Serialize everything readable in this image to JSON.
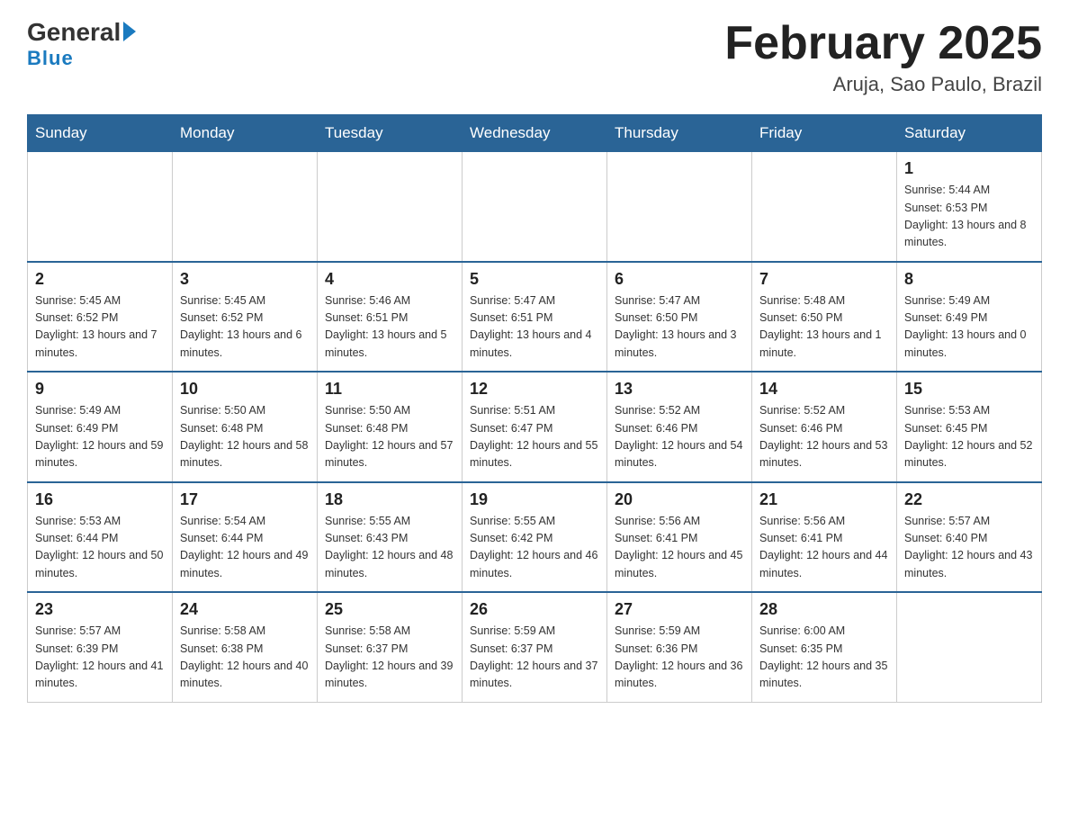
{
  "header": {
    "logo_general": "General",
    "logo_blue": "Blue",
    "title": "February 2025",
    "location": "Aruja, Sao Paulo, Brazil"
  },
  "days_of_week": [
    "Sunday",
    "Monday",
    "Tuesday",
    "Wednesday",
    "Thursday",
    "Friday",
    "Saturday"
  ],
  "weeks": [
    [
      {
        "day": "",
        "info": ""
      },
      {
        "day": "",
        "info": ""
      },
      {
        "day": "",
        "info": ""
      },
      {
        "day": "",
        "info": ""
      },
      {
        "day": "",
        "info": ""
      },
      {
        "day": "",
        "info": ""
      },
      {
        "day": "1",
        "info": "Sunrise: 5:44 AM\nSunset: 6:53 PM\nDaylight: 13 hours and 8 minutes."
      }
    ],
    [
      {
        "day": "2",
        "info": "Sunrise: 5:45 AM\nSunset: 6:52 PM\nDaylight: 13 hours and 7 minutes."
      },
      {
        "day": "3",
        "info": "Sunrise: 5:45 AM\nSunset: 6:52 PM\nDaylight: 13 hours and 6 minutes."
      },
      {
        "day": "4",
        "info": "Sunrise: 5:46 AM\nSunset: 6:51 PM\nDaylight: 13 hours and 5 minutes."
      },
      {
        "day": "5",
        "info": "Sunrise: 5:47 AM\nSunset: 6:51 PM\nDaylight: 13 hours and 4 minutes."
      },
      {
        "day": "6",
        "info": "Sunrise: 5:47 AM\nSunset: 6:50 PM\nDaylight: 13 hours and 3 minutes."
      },
      {
        "day": "7",
        "info": "Sunrise: 5:48 AM\nSunset: 6:50 PM\nDaylight: 13 hours and 1 minute."
      },
      {
        "day": "8",
        "info": "Sunrise: 5:49 AM\nSunset: 6:49 PM\nDaylight: 13 hours and 0 minutes."
      }
    ],
    [
      {
        "day": "9",
        "info": "Sunrise: 5:49 AM\nSunset: 6:49 PM\nDaylight: 12 hours and 59 minutes."
      },
      {
        "day": "10",
        "info": "Sunrise: 5:50 AM\nSunset: 6:48 PM\nDaylight: 12 hours and 58 minutes."
      },
      {
        "day": "11",
        "info": "Sunrise: 5:50 AM\nSunset: 6:48 PM\nDaylight: 12 hours and 57 minutes."
      },
      {
        "day": "12",
        "info": "Sunrise: 5:51 AM\nSunset: 6:47 PM\nDaylight: 12 hours and 55 minutes."
      },
      {
        "day": "13",
        "info": "Sunrise: 5:52 AM\nSunset: 6:46 PM\nDaylight: 12 hours and 54 minutes."
      },
      {
        "day": "14",
        "info": "Sunrise: 5:52 AM\nSunset: 6:46 PM\nDaylight: 12 hours and 53 minutes."
      },
      {
        "day": "15",
        "info": "Sunrise: 5:53 AM\nSunset: 6:45 PM\nDaylight: 12 hours and 52 minutes."
      }
    ],
    [
      {
        "day": "16",
        "info": "Sunrise: 5:53 AM\nSunset: 6:44 PM\nDaylight: 12 hours and 50 minutes."
      },
      {
        "day": "17",
        "info": "Sunrise: 5:54 AM\nSunset: 6:44 PM\nDaylight: 12 hours and 49 minutes."
      },
      {
        "day": "18",
        "info": "Sunrise: 5:55 AM\nSunset: 6:43 PM\nDaylight: 12 hours and 48 minutes."
      },
      {
        "day": "19",
        "info": "Sunrise: 5:55 AM\nSunset: 6:42 PM\nDaylight: 12 hours and 46 minutes."
      },
      {
        "day": "20",
        "info": "Sunrise: 5:56 AM\nSunset: 6:41 PM\nDaylight: 12 hours and 45 minutes."
      },
      {
        "day": "21",
        "info": "Sunrise: 5:56 AM\nSunset: 6:41 PM\nDaylight: 12 hours and 44 minutes."
      },
      {
        "day": "22",
        "info": "Sunrise: 5:57 AM\nSunset: 6:40 PM\nDaylight: 12 hours and 43 minutes."
      }
    ],
    [
      {
        "day": "23",
        "info": "Sunrise: 5:57 AM\nSunset: 6:39 PM\nDaylight: 12 hours and 41 minutes."
      },
      {
        "day": "24",
        "info": "Sunrise: 5:58 AM\nSunset: 6:38 PM\nDaylight: 12 hours and 40 minutes."
      },
      {
        "day": "25",
        "info": "Sunrise: 5:58 AM\nSunset: 6:37 PM\nDaylight: 12 hours and 39 minutes."
      },
      {
        "day": "26",
        "info": "Sunrise: 5:59 AM\nSunset: 6:37 PM\nDaylight: 12 hours and 37 minutes."
      },
      {
        "day": "27",
        "info": "Sunrise: 5:59 AM\nSunset: 6:36 PM\nDaylight: 12 hours and 36 minutes."
      },
      {
        "day": "28",
        "info": "Sunrise: 6:00 AM\nSunset: 6:35 PM\nDaylight: 12 hours and 35 minutes."
      },
      {
        "day": "",
        "info": ""
      }
    ]
  ]
}
